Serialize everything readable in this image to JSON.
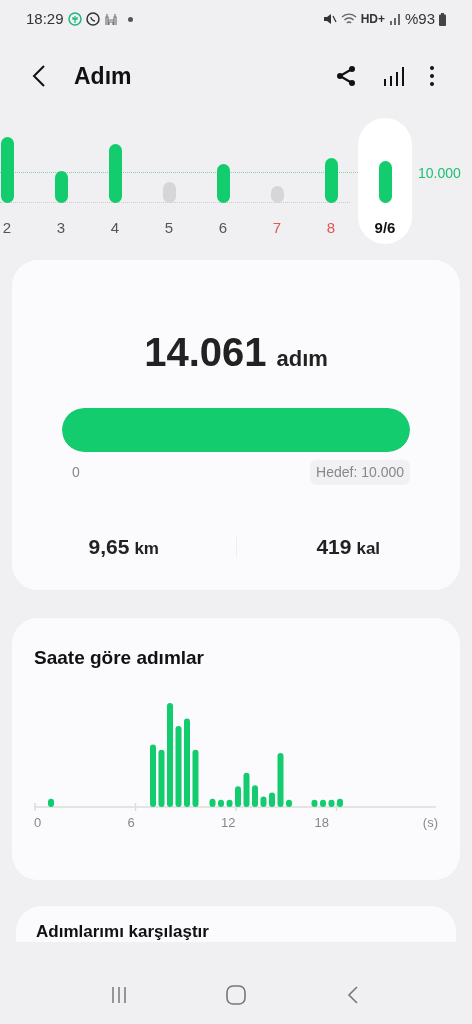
{
  "status_bar": {
    "time": "18:29",
    "battery": "%93",
    "network": "HD+"
  },
  "header": {
    "title": "Adım"
  },
  "week": {
    "goal_label": "10.000",
    "days": [
      {
        "label": "2",
        "goal_met": true,
        "weekend": false,
        "selected": false
      },
      {
        "label": "3",
        "goal_met": true,
        "weekend": false,
        "selected": false
      },
      {
        "label": "4",
        "goal_met": true,
        "weekend": false,
        "selected": false
      },
      {
        "label": "5",
        "goal_met": false,
        "weekend": false,
        "selected": false
      },
      {
        "label": "6",
        "goal_met": true,
        "weekend": false,
        "selected": false
      },
      {
        "label": "7",
        "goal_met": false,
        "weekend": true,
        "selected": false
      },
      {
        "label": "8",
        "goal_met": true,
        "weekend": true,
        "selected": false
      },
      {
        "label": "9/6",
        "goal_met": true,
        "weekend": false,
        "selected": true
      }
    ]
  },
  "summary": {
    "steps": "14.061",
    "steps_unit": "adım",
    "progress": {
      "level": 1,
      "start": "0",
      "goal": "Hedef: 10.000"
    },
    "distance": "9,65",
    "distance_unit": "km",
    "calories": "419",
    "calories_unit": "kal"
  },
  "hourly": {
    "title": "Saate göre adımlar",
    "ticks": [
      "0",
      "6",
      "12",
      "18",
      "(s)"
    ]
  },
  "compare": {
    "title": "Adımlarımı karşılaştır"
  }
}
